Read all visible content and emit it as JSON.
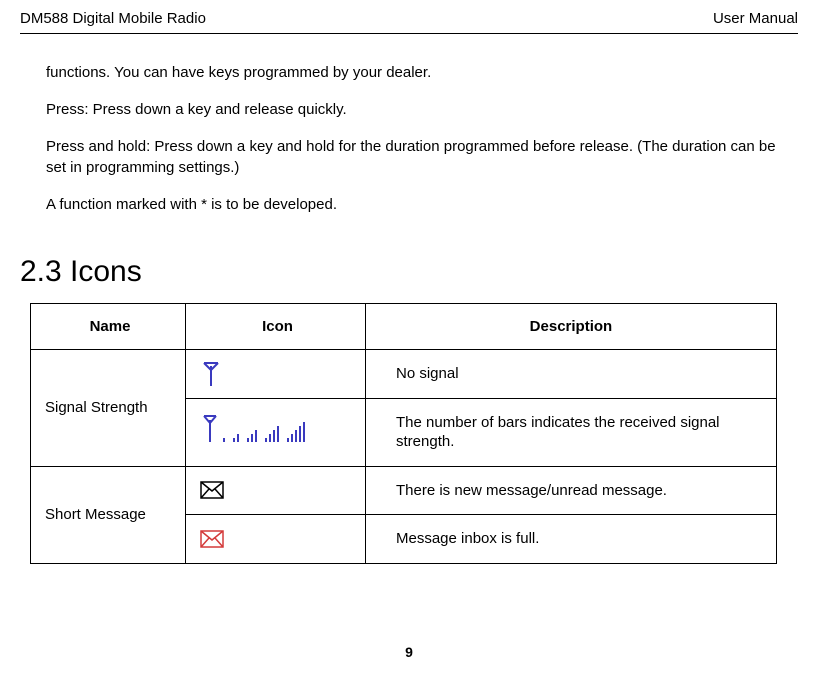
{
  "header": {
    "left": "DM588 Digital Mobile Radio",
    "right": "User Manual"
  },
  "body": {
    "p1": "functions. You can have keys programmed by your dealer.",
    "p2": "Press: Press down a key and release quickly.",
    "p3": "Press and hold: Press down a key and hold for the duration programmed before release. (The duration can be set in programming settings.)",
    "p4": "A function marked with * is to be developed."
  },
  "section": {
    "heading": "2.3 Icons"
  },
  "table": {
    "headers": {
      "name": "Name",
      "icon": "Icon",
      "description": "Description"
    },
    "rows": {
      "signal_name": "Signal Strength",
      "signal_desc1": "No signal",
      "signal_desc2": "The number of bars indicates the received signal strength.",
      "msg_name": "Short Message",
      "msg_desc1": "There is new message/unread message.",
      "msg_desc2": "Message inbox is full."
    }
  },
  "page_number": "9"
}
